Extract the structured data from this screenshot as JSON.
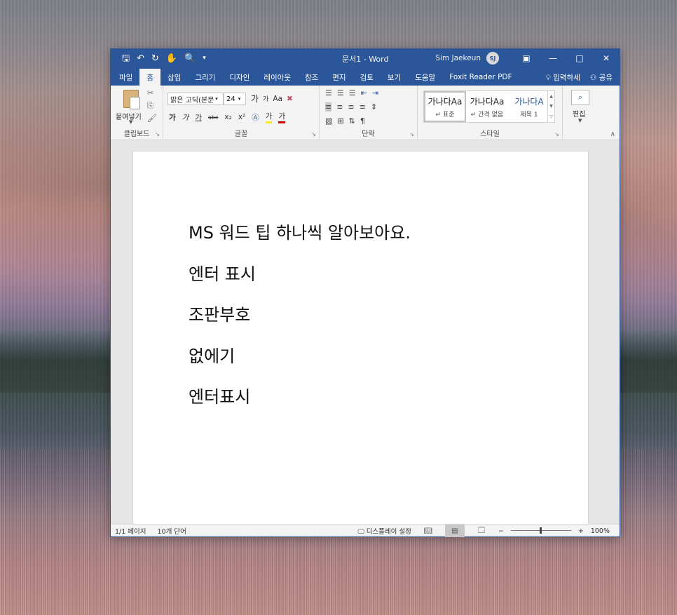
{
  "window": {
    "title": "문서1 - Word",
    "user_name": "Sim Jaekeun",
    "user_initials": "SJ",
    "minimize_icon": "minimize-icon",
    "maximize_icon": "maximize-icon",
    "close_icon": "close-icon"
  },
  "tabs": [
    {
      "label": "파일"
    },
    {
      "label": "홈",
      "active": true
    },
    {
      "label": "삽입"
    },
    {
      "label": "그리기"
    },
    {
      "label": "디자인"
    },
    {
      "label": "레이아웃"
    },
    {
      "label": "참조"
    },
    {
      "label": "편지"
    },
    {
      "label": "검토"
    },
    {
      "label": "보기"
    },
    {
      "label": "도움말"
    },
    {
      "label": "Foxit Reader PDF"
    }
  ],
  "tell_me": "입력하세",
  "share": "공유",
  "ribbon": {
    "clipboard": {
      "paste": "붙여넣기",
      "label": "클립보드"
    },
    "font": {
      "font_name": "맑은 고딕(본문",
      "font_size": "24",
      "grow": "가",
      "shrink": "가",
      "change_case": "Aa",
      "bold": "가",
      "italic": "가",
      "underline": "가",
      "strike": "abc",
      "subscript": "x₂",
      "superscript": "x²",
      "highlight": "가",
      "color": "가",
      "label": "글꼴"
    },
    "paragraph": {
      "label": "단락"
    },
    "styles": {
      "items": [
        {
          "sample": "가나다Aa",
          "name": "↵ 표준"
        },
        {
          "sample": "가나다Aa",
          "name": "↵ 간격 없음"
        },
        {
          "sample": "가나다A",
          "name": "제목 1"
        }
      ],
      "label": "스타일"
    },
    "editing": {
      "label": "편집"
    }
  },
  "document": {
    "lines": [
      "MS 워드 팁 하나씩 알아보아요.",
      "엔터 표시",
      "조판부호",
      "없에기",
      "엔터표시"
    ]
  },
  "status": {
    "page": "1/1 페이지",
    "words": "10개 단어",
    "display_settings": "디스플레이 설정",
    "zoom_minus": "−",
    "zoom_plus": "+",
    "zoom_level": "100%",
    "zoom_fraction": 0.5
  },
  "colors": {
    "accent": "#2b579a"
  }
}
